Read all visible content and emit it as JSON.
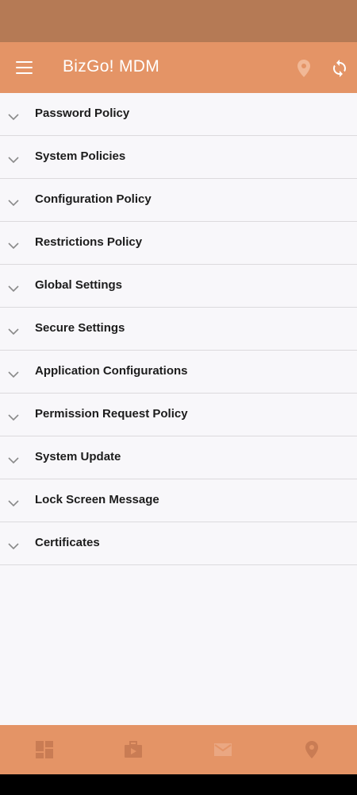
{
  "app_bar": {
    "title": "BizGo! MDM",
    "menu_icon": "menu-icon",
    "location_icon": "location-pin-icon",
    "sync_icon": "sync-icon"
  },
  "policies": {
    "items": [
      {
        "label": "Password Policy"
      },
      {
        "label": "System Policies"
      },
      {
        "label": "Configuration Policy"
      },
      {
        "label": "Restrictions Policy"
      },
      {
        "label": "Global Settings"
      },
      {
        "label": "Secure Settings"
      },
      {
        "label": "Application Configurations"
      },
      {
        "label": "Permission Request Policy"
      },
      {
        "label": "System Update"
      },
      {
        "label": "Lock Screen Message"
      },
      {
        "label": "Certificates"
      }
    ]
  },
  "bottom_nav": {
    "items": [
      "dashboard-icon",
      "briefcase-icon",
      "mail-icon",
      "location-pin-icon"
    ]
  },
  "colors": {
    "accent": "#e49466",
    "status_bar": "#b57a55",
    "background": "#f8f7fa"
  }
}
